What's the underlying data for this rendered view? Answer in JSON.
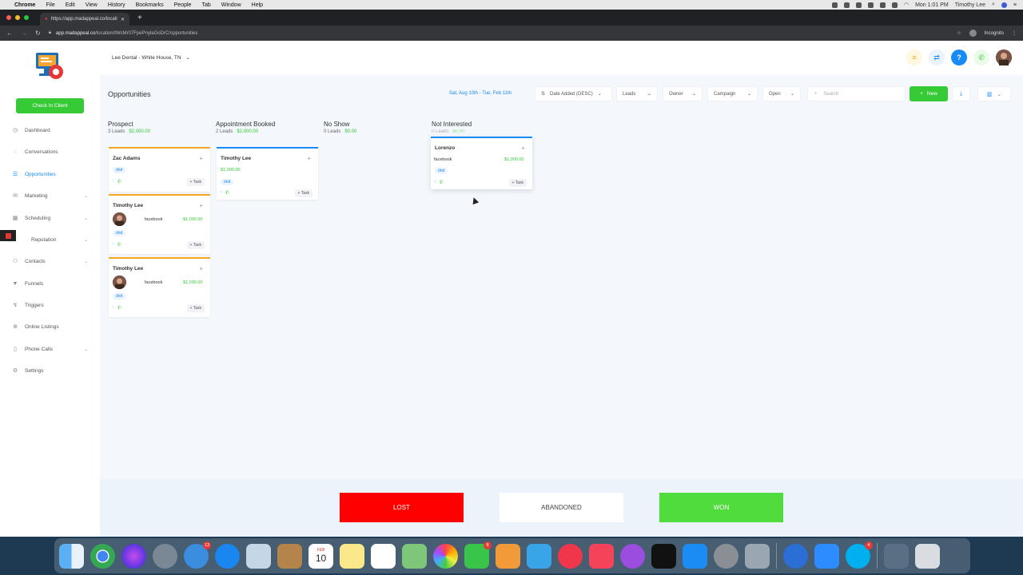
{
  "menubar": {
    "app": "Chrome",
    "items": [
      "File",
      "Edit",
      "View",
      "History",
      "Bookmarks",
      "People",
      "Tab",
      "Window",
      "Help"
    ],
    "clock": "Mon 1:01 PM",
    "user": "Timothy Lee"
  },
  "browser": {
    "tab_title": "https://app.madappeal.co/locati",
    "url_host": "app.madappeal.co",
    "url_path": "/location/tWcMr07FpePnylaGoDrC/opportunities",
    "profile": "Incognito"
  },
  "sidebar": {
    "checkin_label": "Check In Client",
    "items": [
      {
        "label": "Dashboard",
        "icon": "dashboard-icon"
      },
      {
        "label": "Conversations",
        "icon": "chat-icon"
      },
      {
        "label": "Opportunities",
        "icon": "opportunities-icon"
      },
      {
        "label": "Marketing",
        "icon": "marketing-icon"
      },
      {
        "label": "Scheduling",
        "icon": "calendar-icon"
      },
      {
        "label": "Reputation",
        "icon": "star-icon"
      },
      {
        "label": "Contacts",
        "icon": "person-icon"
      },
      {
        "label": "Funnels",
        "icon": "funnel-icon"
      },
      {
        "label": "Triggers",
        "icon": "trigger-icon"
      },
      {
        "label": "Online Listings",
        "icon": "globe-icon"
      },
      {
        "label": "Phone Calls",
        "icon": "phone-icon"
      },
      {
        "label": "Settings",
        "icon": "gear-icon"
      }
    ],
    "active": "Opportunities"
  },
  "topbar": {
    "location": "Lee Dental - White House, TN"
  },
  "toolbar": {
    "title": "Opportunities",
    "date_range": "Sat, Aug 10th - Tue, Feb 11th",
    "sort": "Date Added (DESC)",
    "pipeline": "Leads",
    "owner": "Owner",
    "campaign": "Campaign",
    "status": "Open",
    "search_placeholder": "Search",
    "new_label": "New"
  },
  "columns": [
    {
      "title": "Prospect",
      "count": "3 Leads",
      "amount": "$2,000.00"
    },
    {
      "title": "Appointment Booked",
      "count": "2 Leads",
      "amount": "$2,000.00"
    },
    {
      "title": "No Show",
      "count": "0 Leads",
      "amount": "$0.00"
    },
    {
      "title": "Not Interested",
      "count": "0 Leads",
      "amount": "$0.00"
    }
  ],
  "cards": {
    "c1": {
      "name": "Zac Adams",
      "tag": "dnd",
      "task": "+ Task"
    },
    "c2": {
      "name": "Timothy Lee",
      "source": "facebook",
      "value": "$1,000.00",
      "tag": "dnd",
      "task": "+ Task"
    },
    "c3": {
      "name": "Timothy Lee",
      "source": "facebook",
      "value": "$1,000.00",
      "tag": "dnd",
      "task": "+ Task"
    },
    "c4": {
      "name": "Timothy Lee",
      "value": "$1,000.00",
      "tag": "dnd",
      "task": "+ Task"
    },
    "c5": {
      "name": "Lorenzo",
      "source": "facebook",
      "value": "$1,000.00",
      "tag": "dnd",
      "task": "+ Task"
    }
  },
  "drop_zones": {
    "lost": "LOST",
    "abandoned": "ABANDONED",
    "won": "WON"
  },
  "colors": {
    "accent": "#188bf6",
    "green": "#37ca37",
    "lost": "#ff0000",
    "won": "#4fdc3c"
  },
  "dock": {
    "badges": {
      "mail": "13",
      "facetime": "8",
      "calendar_date": "10",
      "calendar_month": "FEB",
      "skype": "4"
    }
  }
}
